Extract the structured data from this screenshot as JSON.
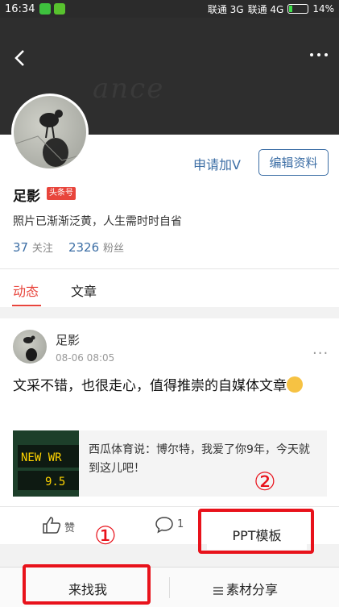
{
  "status_bar": {
    "time": "16:34",
    "carrier1": "联通 3G",
    "carrier2": "联通 4G",
    "battery": "14%"
  },
  "header": {
    "watermark": "ance"
  },
  "profile": {
    "apply_label": "申请加V",
    "edit_label": "编辑资料",
    "name": "足影",
    "badge": "头条号",
    "bio": "照片已渐渐泛黄，人生需时时自省",
    "following_count": "37",
    "following_label": "关注",
    "followers_count": "2326",
    "followers_label": "粉丝"
  },
  "tabs": [
    {
      "label": "动态",
      "active": true
    },
    {
      "label": "文章",
      "active": false
    }
  ],
  "post": {
    "author": "足影",
    "time": "08-06 08:05",
    "more": "···",
    "text": "文采不错，也很走心，值得推崇的自媒体文章",
    "link_text": "西瓜体育说：博尔特，我爱了你9年，今天就到这儿吧！",
    "like_label": "赞",
    "comment_count": "1"
  },
  "annotations": {
    "marker1": "①",
    "marker2": "②",
    "ppt_label": "PPT模板"
  },
  "bottom_bar": {
    "find_label": "来找我",
    "material_label": "素材分享"
  },
  "colors": {
    "accent": "#e8453c",
    "link_blue": "#3c6ea5",
    "annotation_red": "#e8121b"
  }
}
